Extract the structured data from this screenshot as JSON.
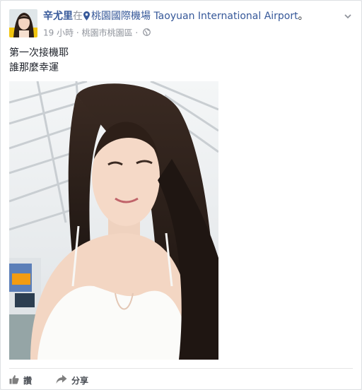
{
  "post": {
    "author": "辛尤里",
    "checkin_word": "在",
    "location": "桃園國際機場 Taoyuan International Airport",
    "end_mark": "。",
    "time": "19 小時",
    "separator": "·",
    "place_line": "桃園市桃園區",
    "privacy_icon": "globe-icon",
    "text_lines": [
      "第一次接機耶",
      "誰那麼幸運"
    ]
  },
  "actions": {
    "like_label": "讚",
    "share_label": "分享"
  },
  "colors": {
    "link": "#365899",
    "meta": "#90949c",
    "text": "#1d2129"
  }
}
